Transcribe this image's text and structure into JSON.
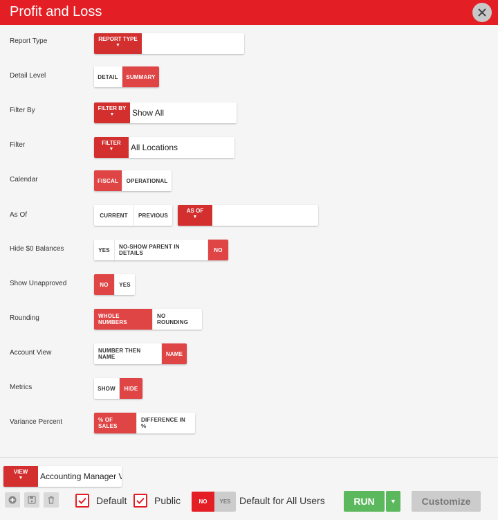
{
  "title": "Profit and Loss",
  "rows": {
    "report_type": {
      "label": "Report Type",
      "dropdown": "REPORT TYPE",
      "value": ""
    },
    "detail_level": {
      "label": "Detail Level",
      "options": [
        "DETAIL",
        "SUMMARY"
      ],
      "selected": "SUMMARY"
    },
    "filter_by": {
      "label": "Filter By",
      "dropdown": "FILTER BY",
      "value": "Show All"
    },
    "filter": {
      "label": "Filter",
      "dropdown": "FILTER",
      "value": "All Locations"
    },
    "calendar": {
      "label": "Calendar",
      "options": [
        "FISCAL",
        "OPERATIONAL"
      ],
      "selected": "FISCAL"
    },
    "as_of": {
      "label": "As Of",
      "options": [
        "CURRENT",
        "PREVIOUS"
      ],
      "dropdown": "AS OF",
      "value": ""
    },
    "hide_zero": {
      "label": "Hide $0 Balances",
      "options": [
        "YES",
        "NO-SHOW PARENT IN DETAILS",
        "NO"
      ],
      "selected": "NO"
    },
    "show_unapproved": {
      "label": "Show Unapproved",
      "options": [
        "NO",
        "YES"
      ],
      "selected": "NO"
    },
    "rounding": {
      "label": "Rounding",
      "options": [
        "WHOLE NUMBERS",
        "NO ROUNDING"
      ],
      "selected": "WHOLE NUMBERS"
    },
    "account_view": {
      "label": "Account View",
      "options": [
        "NUMBER THEN NAME",
        "NAME"
      ],
      "selected": "NAME"
    },
    "metrics": {
      "label": "Metrics",
      "options": [
        "SHOW",
        "HIDE"
      ],
      "selected": "HIDE"
    },
    "variance_percent": {
      "label": "Variance Percent",
      "options": [
        "% OF SALES",
        "DIFFERENCE IN %"
      ],
      "selected": "% OF SALES"
    }
  },
  "footer": {
    "view_dropdown": "VIEW",
    "view_value": "Accounting Manager V",
    "icons": [
      "plus-circle-icon",
      "save-icon",
      "trash-icon"
    ],
    "default_label": "Default",
    "default_checked": true,
    "public_label": "Public",
    "public_checked": true,
    "toggle_no": "NO",
    "toggle_yes": "YES",
    "toggle_selected": "NO",
    "default_all_users_label": "Default for All Users",
    "run_label": "RUN",
    "customize_label": "Customize"
  },
  "colors": {
    "title_bar": "#e31e24",
    "active_option": "#e04546",
    "dropdown": "#d32f2f",
    "run": "#5cb85c",
    "disabled": "#cccccc"
  }
}
